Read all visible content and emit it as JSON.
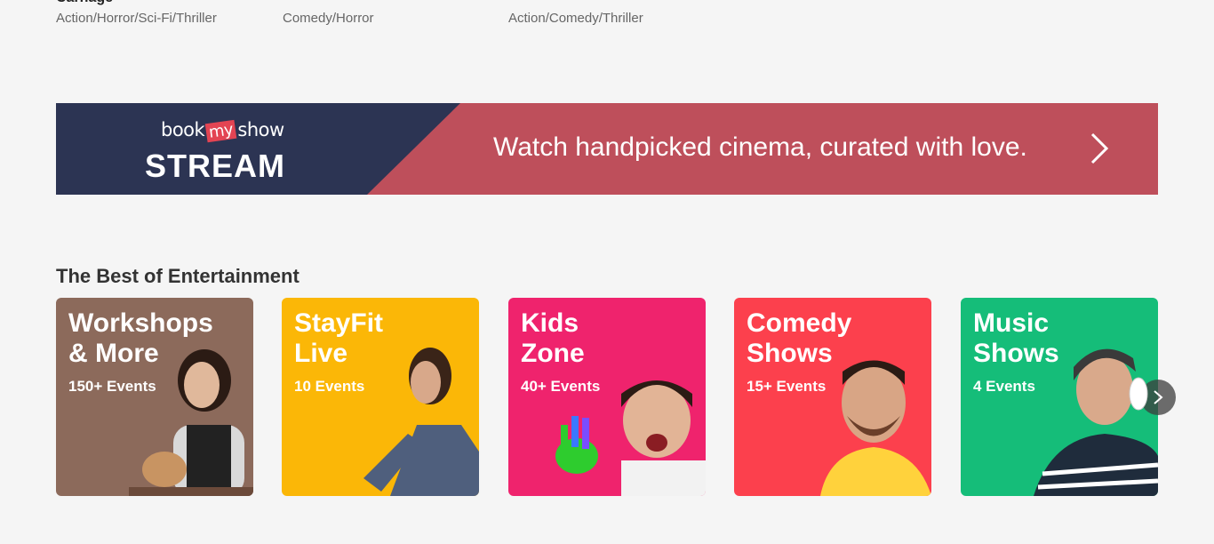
{
  "movies": [
    {
      "title": "Carnage",
      "genre": "Action/Horror/Sci-Fi/Thriller"
    },
    {
      "title": "",
      "genre": "Comedy/Horror"
    },
    {
      "title": "",
      "genre": "Action/Comedy/Thriller"
    }
  ],
  "banner": {
    "brand_book": "book",
    "brand_my": "my",
    "brand_show": "show",
    "product": "STREAM",
    "tagline": "Watch handpicked cinema, curated with love."
  },
  "section": {
    "title": "The Best of Entertainment",
    "tiles": [
      {
        "title": "Workshops\n& More",
        "count": "150+ Events",
        "color": "#8c6a5b"
      },
      {
        "title": "StayFit\nLive",
        "count": "10 Events",
        "color": "#fbb707"
      },
      {
        "title": "Kids\nZone",
        "count": "40+ Events",
        "color": "#ef236d"
      },
      {
        "title": "Comedy\nShows",
        "count": "15+ Events",
        "color": "#fc404d"
      },
      {
        "title": "Music\nShows",
        "count": "4 Events",
        "color": "#15bd79"
      }
    ]
  },
  "icons": {
    "next": "chevron-right-icon",
    "banner_arrow": "chevron-right-icon"
  }
}
